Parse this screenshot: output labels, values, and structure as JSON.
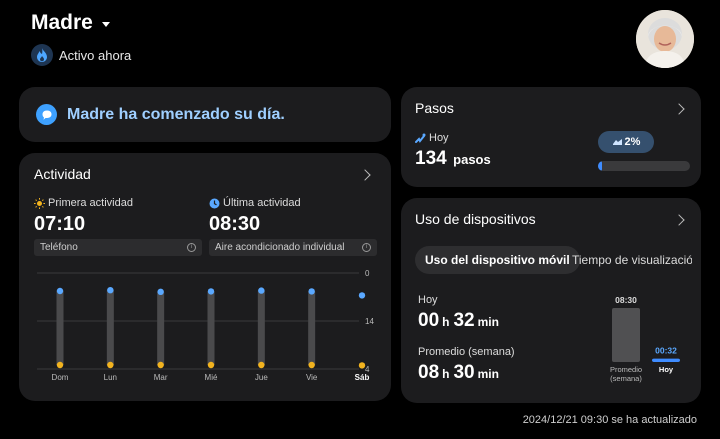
{
  "header": {
    "name": "Madre",
    "status": "Activo ahora"
  },
  "banner": {
    "text": "Madre ha comenzado su día."
  },
  "activity": {
    "title": "Actividad",
    "first_label": "Primera actividad",
    "first_time": "07:10",
    "first_device": "Teléfono",
    "last_label": "Última actividad",
    "last_time": "08:30",
    "last_device": "Aire acondicionado individual",
    "chart_data": {
      "type": "bar",
      "categories": [
        "Dom",
        "Lun",
        "Mar",
        "Mié",
        "Jue",
        "Vie",
        "Sáb"
      ],
      "highlight_category": "Sáb",
      "y_ticks": [
        "0",
        "14",
        "4"
      ],
      "series": [
        {
          "start_values": [
            4.5,
            4.3,
            4.7,
            4.6,
            4.4,
            4.6,
            5.6
          ]
        },
        {
          "end_values": [
            23.0,
            23.0,
            23.0,
            23.0,
            23.0,
            23.0,
            23.1
          ]
        }
      ],
      "colors": {
        "start_dot": "#5aa8ff",
        "end_dot": "#f2b31f",
        "bar": "#4a4a4c"
      }
    }
  },
  "steps": {
    "title": "Pasos",
    "today_label": "Hoy",
    "count": "134",
    "unit": "pasos",
    "badge": "2%",
    "progress": 0.02
  },
  "devices": {
    "title": "Uso de dispositivos",
    "tab_active": "Uso del dispositivo móvil",
    "tab_inactive": "Tiempo de visualización",
    "today_label": "Hoy",
    "today_hours": "00",
    "today_minutes": "32",
    "avg_label": "Promedio (semana)",
    "avg_hours": "08",
    "avg_minutes": "30",
    "h_unit": "h",
    "min_unit": "min",
    "chart_data": {
      "type": "bar",
      "categories": [
        "Promedio (semana)",
        "Hoy"
      ],
      "values": [
        "08:30",
        "00:32"
      ],
      "minutes": [
        510,
        32
      ],
      "colors": [
        "#505052",
        "#3f8cff"
      ]
    }
  },
  "footer": {
    "updated": "2024/12/21 09:30 se ha actualizado"
  },
  "colors": {
    "background": "#000000",
    "card": "#1c1c1e",
    "accent_blue": "#3ea1ff",
    "banner_text": "#9fcfff",
    "orange": "#f2b31f"
  }
}
